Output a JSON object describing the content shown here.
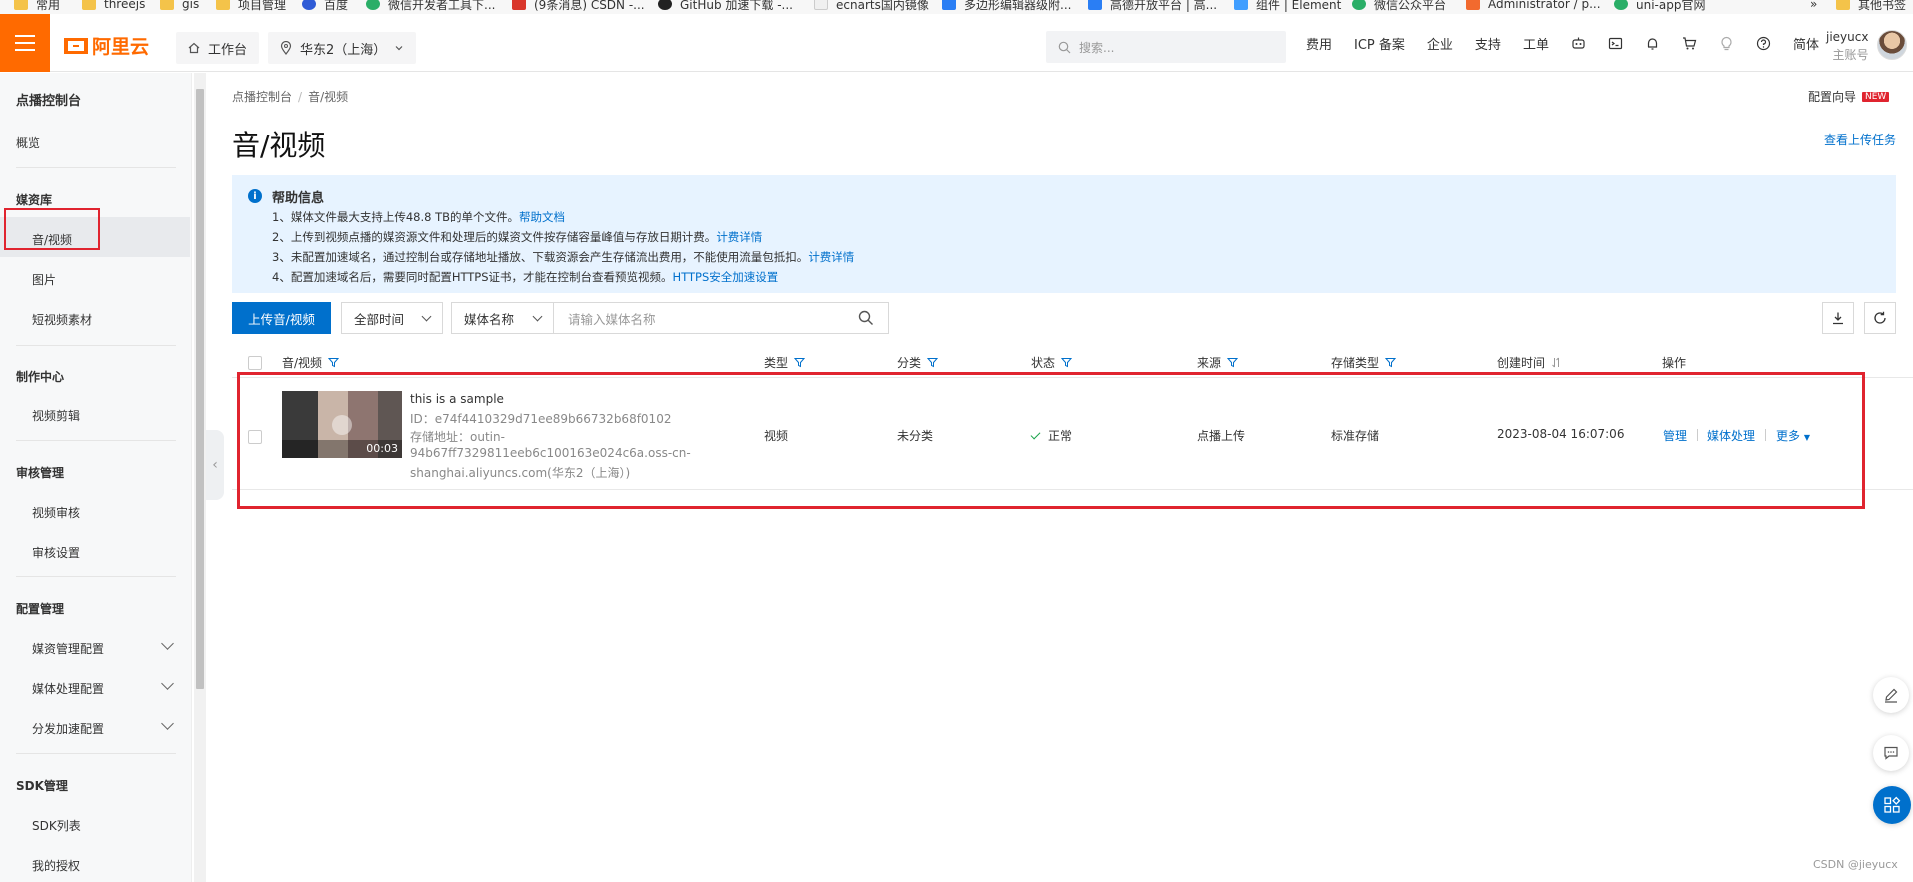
{
  "bookmarks": [
    {
      "label": "常用",
      "icon": "folder"
    },
    {
      "label": "threejs",
      "icon": "folder"
    },
    {
      "label": "gis",
      "icon": "folder"
    },
    {
      "label": "项目管理",
      "icon": "folder"
    },
    {
      "label": "百度",
      "icon": "paw"
    },
    {
      "label": "微信开发者工具下...",
      "icon": "green"
    },
    {
      "label": "(9条消息) CSDN -...",
      "icon": "red"
    },
    {
      "label": "GitHub 加速下载 -...",
      "icon": "dark"
    },
    {
      "label": "ecnarts国内镜像",
      "icon": "gl"
    },
    {
      "label": "多边形编辑器级附...",
      "icon": "blue"
    },
    {
      "label": "高德开放平台 | 高...",
      "icon": "blue"
    },
    {
      "label": "组件 | Element",
      "icon": "el"
    },
    {
      "label": "微信公众平台",
      "icon": "green"
    },
    {
      "label": "Administrator / p...",
      "icon": "orange"
    },
    {
      "label": "uni-app官网",
      "icon": "green"
    },
    {
      "label": "»",
      "icon": ""
    },
    {
      "label": "其他书签",
      "icon": "folder"
    }
  ],
  "topnav": {
    "logo": "阿里云",
    "workbench": "工作台",
    "region": "华东2（上海）",
    "search_placeholder": "搜索...",
    "links": [
      "费用",
      "ICP 备案",
      "企业",
      "支持",
      "工单"
    ],
    "lang": "简体",
    "username": "jieyucx",
    "account_type": "主账号"
  },
  "sidebar": {
    "title": "点播控制台",
    "overview": "概览",
    "groups": [
      {
        "title": "媒资库",
        "items": [
          "音/视频",
          "图片",
          "短视频素材"
        ]
      },
      {
        "title": "制作中心",
        "items": [
          "视频剪辑"
        ]
      },
      {
        "title": "审核管理",
        "items": [
          "视频审核",
          "审核设置"
        ]
      },
      {
        "title": "配置管理",
        "items": [
          "媒资管理配置",
          "媒体处理配置",
          "分发加速配置"
        ]
      },
      {
        "title": "SDK管理",
        "items": [
          "SDK列表",
          "我的授权"
        ]
      }
    ],
    "active": "音/视频"
  },
  "main": {
    "breadcrumb": [
      "点播控制台",
      "音/视频"
    ],
    "config_guide": "配置向导",
    "new_badge": "NEW",
    "title": "音/视频",
    "upload_tasks": "查看上传任务",
    "help": {
      "title": "帮助信息",
      "lines": [
        {
          "text": "1、媒体文件最大支持上传48.8 TB的单个文件。",
          "link": "帮助文档"
        },
        {
          "text": "2、上传到视频点播的媒资源文件和处理后的媒资文件按存储容量峰值与存放日期计费。",
          "link": "计费详情"
        },
        {
          "text": "3、未配置加速域名，通过控制台或存储地址播放、下载资源会产生存储流出费用，不能使用流量包抵扣。",
          "link": "计费详情"
        },
        {
          "text": "4、配置加速域名后，需要同时配置HTTPS证书，才能在控制台查看预览视频。",
          "link": "HTTPS安全加速设置"
        }
      ]
    },
    "toolbar": {
      "upload_button": "上传音/视频",
      "time_filter": "全部时间",
      "field_select": "媒体名称",
      "search_placeholder": "请输入媒体名称"
    },
    "table": {
      "headers": [
        "音/视频",
        "类型",
        "分类",
        "状态",
        "来源",
        "存储类型",
        "创建时间",
        "操作"
      ],
      "rows": [
        {
          "title": "this is a sample",
          "id": "ID：e74f4410329d71ee89b66732b68f0102",
          "storage_line1": "存储地址：outin-",
          "storage_line2": "94b67ff7329811eeb6c100163e024c6a.oss-cn-",
          "storage_line3": "shanghai.aliyuncs.com(华东2（上海）)",
          "duration": "00:03",
          "type": "视频",
          "category": "未分类",
          "status": "正常",
          "source": "点播上传",
          "storage_type": "标准存储",
          "created": "2023-08-04 16:07:06",
          "actions": [
            "管理",
            "媒体处理",
            "更多"
          ]
        }
      ]
    }
  },
  "watermark": "CSDN @jieyucx"
}
